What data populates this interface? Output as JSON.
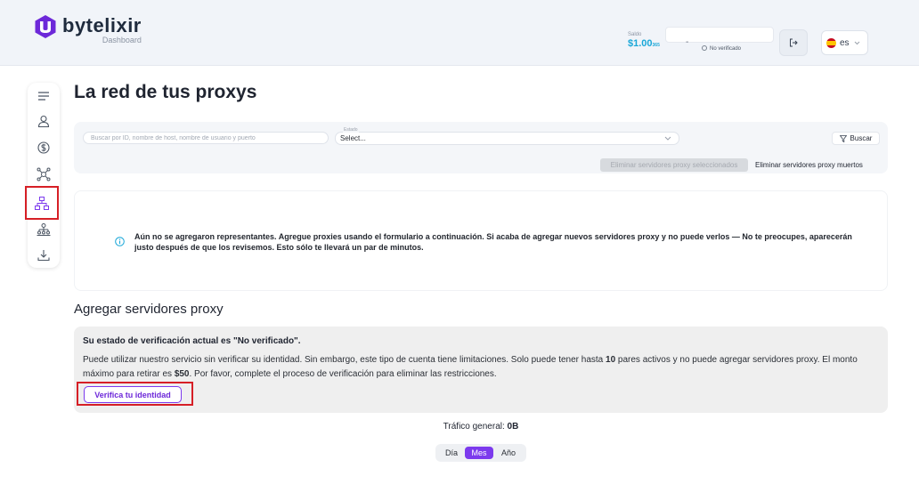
{
  "brand": {
    "name": "bytelixir",
    "subtitle": "Dashboard",
    "color": "#6d28d9"
  },
  "header": {
    "balance_label": "Saldo",
    "balance_value": "$1.00",
    "balance_currency": "365",
    "verification_dash": "-",
    "verification_status": "No verificado",
    "language_code": "es",
    "icons": [
      "logout-icon",
      "spain-flag-icon",
      "chevron-down-icon"
    ]
  },
  "sidebar": {
    "items": [
      {
        "name": "menu",
        "icon": "menu-icon"
      },
      {
        "name": "profile",
        "icon": "user-icon"
      },
      {
        "name": "billing",
        "icon": "dollar-icon"
      },
      {
        "name": "network",
        "icon": "network-icon"
      },
      {
        "name": "proxies",
        "icon": "sitemap-icon",
        "active": true
      },
      {
        "name": "referrals",
        "icon": "team-icon"
      },
      {
        "name": "download",
        "icon": "download-icon"
      }
    ]
  },
  "main": {
    "title": "La red de tus proxys"
  },
  "filters": {
    "search_placeholder": "Buscar por ID, nombre de host, nombre de usuario y puerto",
    "select_label": "Estado",
    "select_value": "Select...",
    "search_button": "Buscar",
    "delete_selected": "Eliminar servidores proxy seleccionados",
    "delete_dead": "Eliminar servidores proxy muertos"
  },
  "info": {
    "message": "Aún no se agregaron representantes. Agregue proxies usando el formulario a continuación. Si acaba de agregar nuevos servidores proxy y no puede verlos — No te preocupes, aparecerán justo después de que los revisemos. Esto sólo te llevará un par de minutos."
  },
  "add_section": {
    "title": "Agregar servidores proxy",
    "heading": "Su estado de verificación actual es \"No verificado\".",
    "body_1": "Puede utilizar nuestro servicio sin verificar su identidad. Sin embargo, este tipo de cuenta tiene limitaciones. Solo puede tener hasta ",
    "body_limit": "10",
    "body_2": " pares activos y no puede agregar servidores proxy. El monto máximo para retirar es ",
    "body_max": "$50",
    "body_3": ". Por favor, complete el proceso de verificación para eliminar las restricciones.",
    "verify_button": "Verifica tu identidad"
  },
  "traffic": {
    "label": "Tráfico general: ",
    "value": "0B"
  },
  "period": {
    "options": [
      "Día",
      "Mes",
      "Año"
    ],
    "selected": "Mes"
  },
  "colors": {
    "accent": "#7c3aed",
    "balance": "#1aa7d8",
    "highlight_outline": "#d61f26"
  }
}
